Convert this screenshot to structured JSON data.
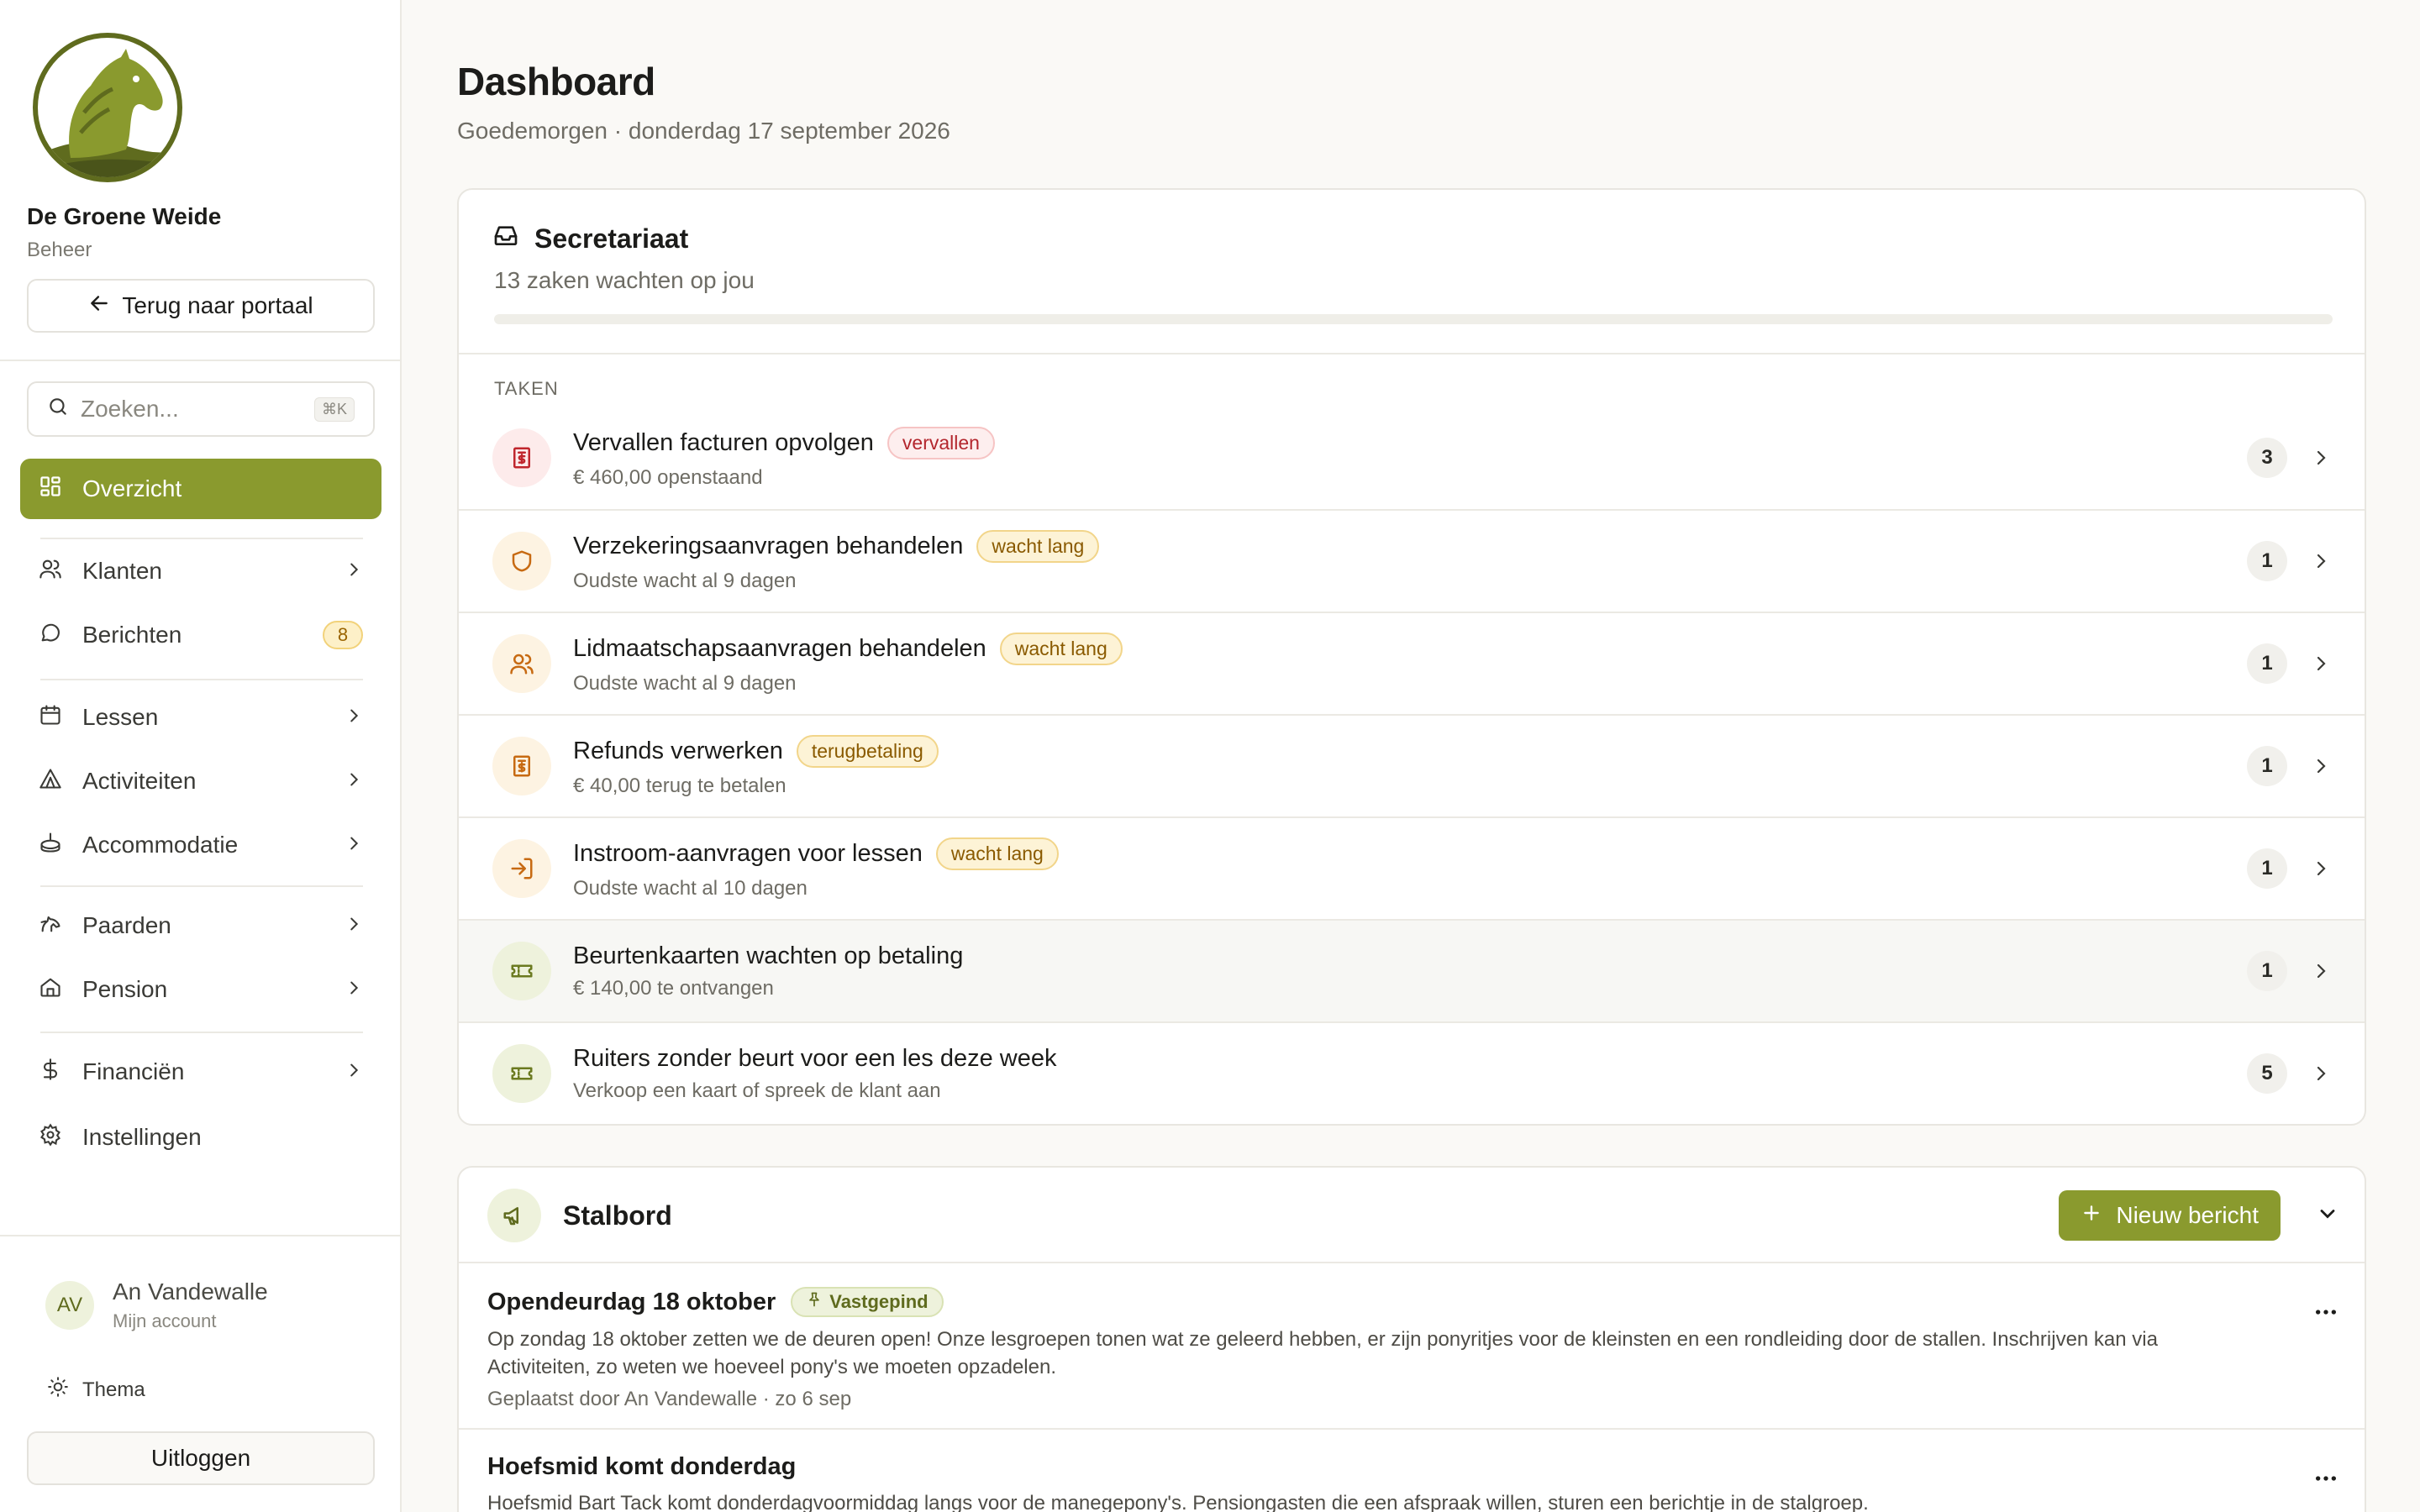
{
  "sidebar": {
    "org_name": "De Groene Weide",
    "org_role": "Beheer",
    "back_label": "Terug naar portaal",
    "search_placeholder": "Zoeken...",
    "search_shortcut": "⌘K",
    "nav": [
      {
        "label": "Overzicht",
        "icon": "grid-icon",
        "active": true
      },
      {
        "label": "Klanten",
        "icon": "users-icon",
        "chevron": true
      },
      {
        "label": "Berichten",
        "icon": "chat-icon",
        "badge": "8"
      },
      {
        "label": "Lessen",
        "icon": "calendar-icon",
        "chevron": true
      },
      {
        "label": "Activiteiten",
        "icon": "tent-icon",
        "chevron": true
      },
      {
        "label": "Accommodatie",
        "icon": "arena-icon",
        "chevron": true
      },
      {
        "label": "Paarden",
        "icon": "horse-icon",
        "chevron": true
      },
      {
        "label": "Pension",
        "icon": "home-icon",
        "chevron": true
      },
      {
        "label": "Financiën",
        "icon": "dollar-icon",
        "chevron": true
      },
      {
        "label": "Instellingen",
        "icon": "gear-icon"
      }
    ],
    "user": {
      "initials": "AV",
      "name": "An Vandewalle",
      "sub": "Mijn account"
    },
    "theme_label": "Thema",
    "logout_label": "Uitloggen"
  },
  "header": {
    "title": "Dashboard",
    "subtitle": "Goedemorgen · donderdag 17 september 2026"
  },
  "secretariaat": {
    "title": "Secretariaat",
    "subtitle": "13 zaken wachten op jou",
    "progress": 0,
    "section_label": "TAKEN",
    "tasks": [
      {
        "title": "Vervallen facturen opvolgen",
        "tag": "vervallen",
        "tag_style": "red",
        "sub": "€ 460,00 openstaand",
        "count": "3",
        "icon": "invoice-icon",
        "icon_style": "red"
      },
      {
        "title": "Verzekeringsaanvragen behandelen",
        "tag": "wacht lang",
        "tag_style": "amber",
        "sub": "Oudste wacht al 9 dagen",
        "count": "1",
        "icon": "shield-icon",
        "icon_style": "amber"
      },
      {
        "title": "Lidmaatschapsaanvragen behandelen",
        "tag": "wacht lang",
        "tag_style": "amber",
        "sub": "Oudste wacht al 9 dagen",
        "count": "1",
        "icon": "users-icon",
        "icon_style": "amber"
      },
      {
        "title": "Refunds verwerken",
        "tag": "terugbetaling",
        "tag_style": "amber",
        "sub": "€ 40,00 terug te betalen",
        "count": "1",
        "icon": "invoice-icon",
        "icon_style": "amber"
      },
      {
        "title": "Instroom-aanvragen voor lessen",
        "tag": "wacht lang",
        "tag_style": "amber",
        "sub": "Oudste wacht al 10 dagen",
        "count": "1",
        "icon": "login-icon",
        "icon_style": "amber"
      },
      {
        "title": "Beurtenkaarten wachten op betaling",
        "tag": "",
        "tag_style": "",
        "sub": "€ 140,00 te ontvangen",
        "count": "1",
        "icon": "ticket-icon",
        "icon_style": "green"
      },
      {
        "title": "Ruiters zonder beurt voor een les deze week",
        "tag": "",
        "tag_style": "",
        "sub": "Verkoop een kaart of spreek de klant aan",
        "count": "5",
        "icon": "ticket-icon",
        "icon_style": "green"
      }
    ]
  },
  "stalbord": {
    "title": "Stalbord",
    "new_label": "Nieuw bericht",
    "posts": [
      {
        "title": "Opendeurdag 18 oktober",
        "pin_label": "Vastgepind",
        "body": "Op zondag 18 oktober zetten we de deuren open! Onze lesgroepen tonen wat ze geleerd hebben, er zijn ponyritjes voor de kleinsten en een rondleiding door de stallen. Inschrijven kan via Activiteiten, zo weten we hoeveel pony's we moeten opzadelen.",
        "meta": "Geplaatst door An Vandewalle · zo 6 sep"
      },
      {
        "title": "Hoefsmid komt donderdag",
        "pin_label": "",
        "body": "Hoefsmid Bart Tack komt donderdagvoormiddag langs voor de manegepony's. Pensiongasten die een afspraak willen, sturen een berichtje in de stalgroep.",
        "meta": ""
      }
    ]
  },
  "colors": {
    "accent": "#8a9a2e",
    "danger": "#c0262d",
    "warning": "#c76a12"
  }
}
